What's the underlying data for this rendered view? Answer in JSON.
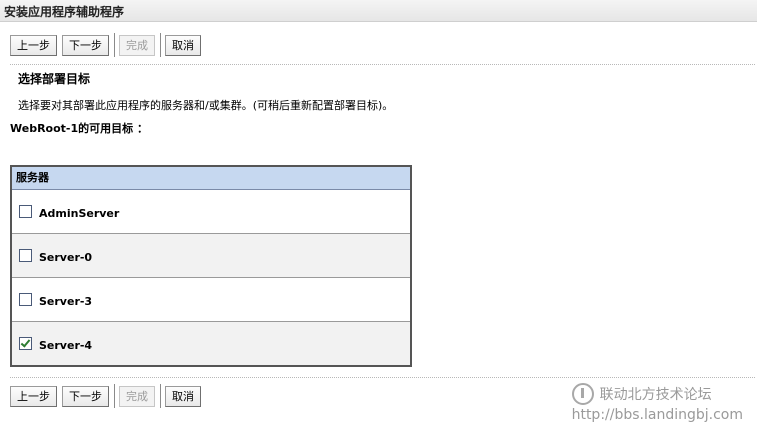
{
  "window": {
    "title": "安装应用程序辅助程序"
  },
  "toolbar_top": {
    "back": "上一步",
    "next": "下一步",
    "finish": "完成",
    "cancel": "取消"
  },
  "section": {
    "heading": "选择部署目标",
    "description": "选择要对其部署此应用程序的服务器和/或集群。(可稍后重新配置部署目标)。",
    "available_targets": "WebRoot-1的可用目标 ："
  },
  "servers_table": {
    "header": "服务器",
    "rows": [
      {
        "label": "AdminServer",
        "checked": false
      },
      {
        "label": "Server-0",
        "checked": false
      },
      {
        "label": "Server-3",
        "checked": false
      },
      {
        "label": "Server-4",
        "checked": true
      }
    ]
  },
  "toolbar_bottom": {
    "back": "上一步",
    "next": "下一步",
    "finish": "完成",
    "cancel": "取消"
  },
  "watermark": {
    "site_name": "联动北方技术论坛",
    "url": "http://bbs.landingbj.com"
  }
}
